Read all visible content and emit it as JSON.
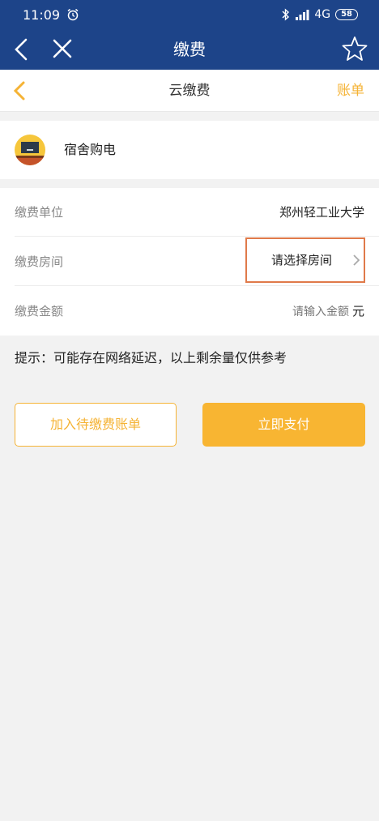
{
  "status_bar": {
    "time": "11:09",
    "network": "4G",
    "battery": "58"
  },
  "header": {
    "title": "缴费"
  },
  "subheader": {
    "title": "云缴费",
    "bill_link": "账单"
  },
  "card": {
    "label": "宿舍购电"
  },
  "form": {
    "unit_label": "缴费单位",
    "unit_value": "郑州轻工业大学",
    "room_label": "缴费房间",
    "room_placeholder": "请选择房间",
    "amount_label": "缴费金额",
    "amount_placeholder": "请输入金额",
    "amount_unit": "元"
  },
  "tip": "提示：可能存在网络延迟，以上剩余量仅供参考",
  "buttons": {
    "add_pending": "加入待缴费账单",
    "pay_now": "立即支付"
  },
  "colors": {
    "header_bg": "#1d4489",
    "accent": "#f5b335",
    "highlight_border": "#e07a4a"
  }
}
